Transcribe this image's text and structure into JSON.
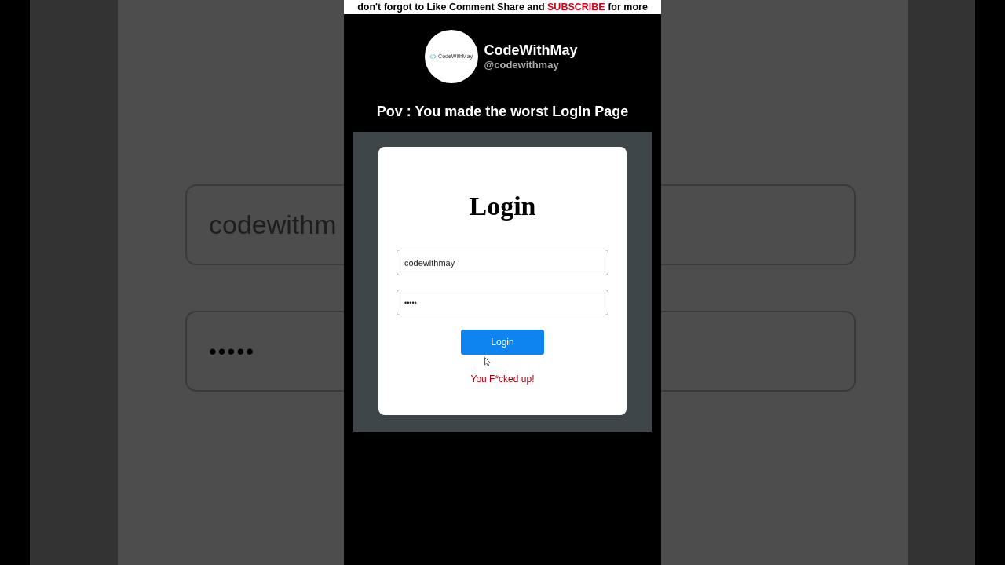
{
  "banner": {
    "parts": [
      {
        "text": "don't forgot to Like Comment Share and ",
        "kind": "plain"
      },
      {
        "text": "SUBSCRIBE",
        "kind": "highlight"
      },
      {
        "text": " for more",
        "kind": "plain"
      }
    ]
  },
  "channel": {
    "logo_text": "CodeWithMay",
    "name": "CodeWithMay",
    "handle": "@codewithmay"
  },
  "caption": "Pov : You made the worst Login Page",
  "background_fields": [
    "codewithm",
    "•••••"
  ],
  "login": {
    "title": "Login",
    "username": "codewithmay",
    "password": "•••••",
    "button": "Login",
    "error": "You F*cked up!"
  }
}
